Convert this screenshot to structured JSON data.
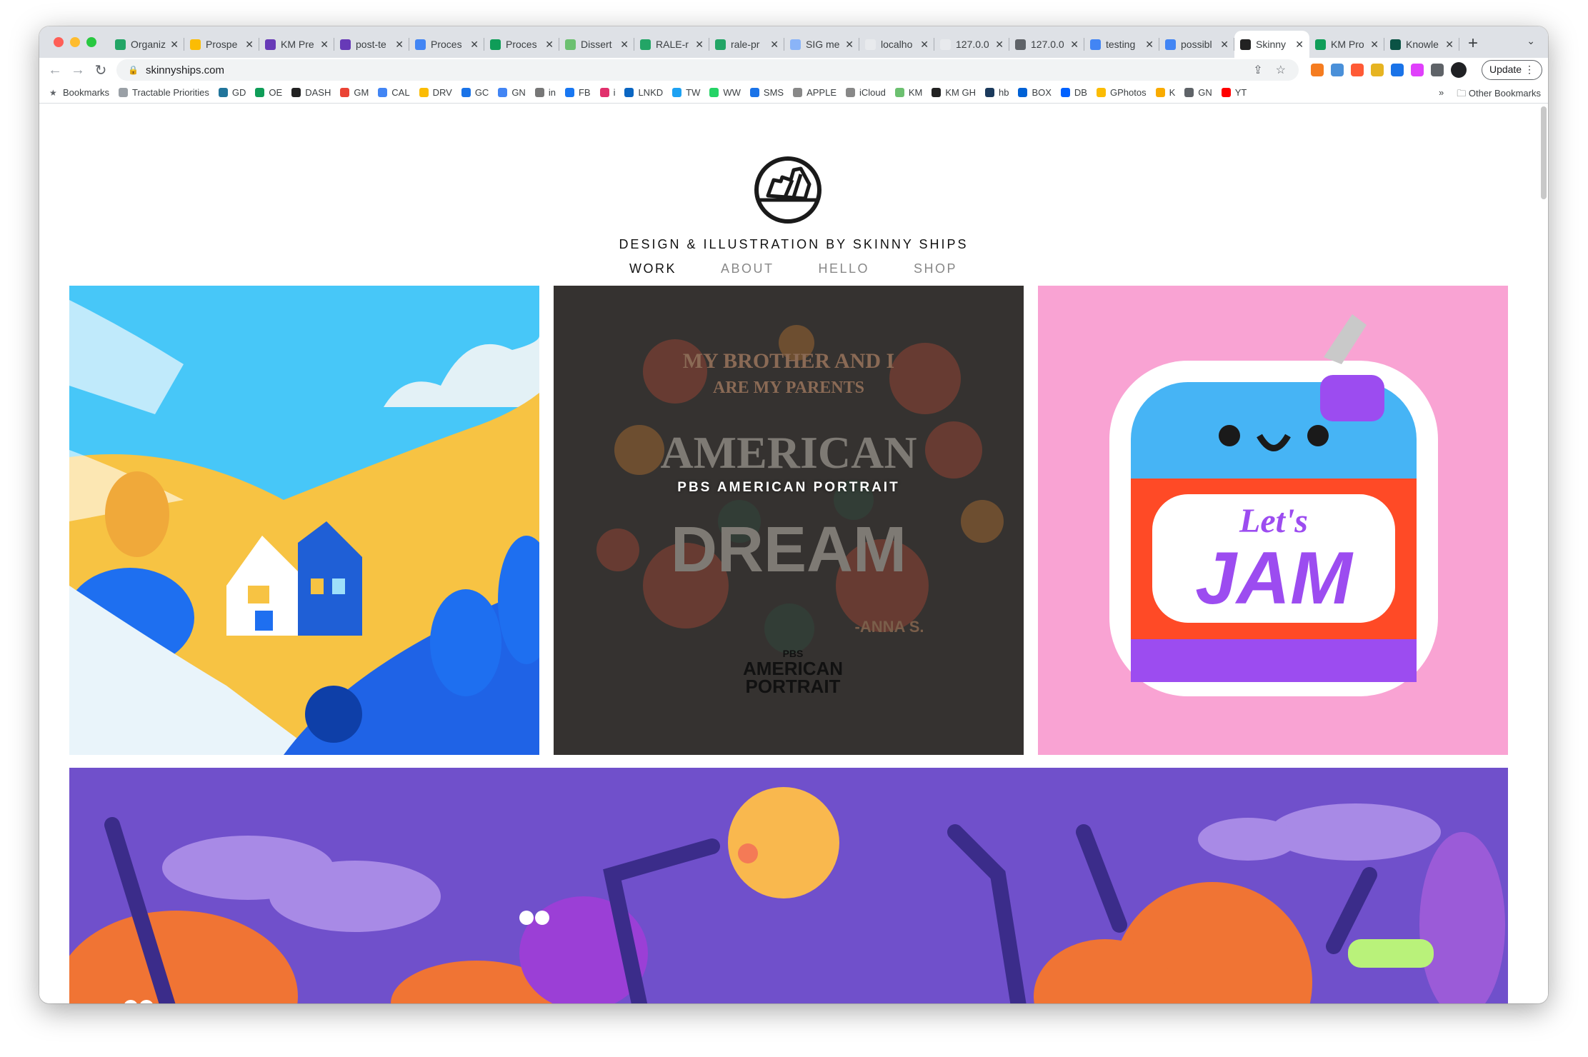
{
  "browser": {
    "tabs": [
      {
        "title": "Organiz",
        "color": "#23a566"
      },
      {
        "title": "Prospe",
        "color": "#fbbc04"
      },
      {
        "title": "KM Pre",
        "color": "#673ab7"
      },
      {
        "title": "post-te",
        "color": "#673ab7"
      },
      {
        "title": "Proces",
        "color": "#4285f4"
      },
      {
        "title": "Proces",
        "color": "#0f9d58"
      },
      {
        "title": "Dissert",
        "color": "#6cc070"
      },
      {
        "title": "RALE-r",
        "color": "#23a566"
      },
      {
        "title": "rale-pr",
        "color": "#23a566"
      },
      {
        "title": "SIG me",
        "color": "#8ab4f8"
      },
      {
        "title": "localho",
        "color": "#e8eaed"
      },
      {
        "title": "127.0.0",
        "color": "#e8eaed"
      },
      {
        "title": "127.0.0",
        "color": "#5f6368"
      },
      {
        "title": "testing",
        "color": "#4285f4"
      },
      {
        "title": "possibl",
        "color": "#4285f4"
      },
      {
        "title": "Skinny",
        "color": "#222222",
        "active": true
      },
      {
        "title": "KM Pro",
        "color": "#0f9d58"
      },
      {
        "title": "Knowle",
        "color": "#0b5345"
      }
    ],
    "url": "skinnyships.com",
    "update_label": "Update",
    "bookmarks": [
      {
        "label": "Bookmarks",
        "color": "#5f6368"
      },
      {
        "label": "Tractable Priorities",
        "color": "#9aa0a6"
      },
      {
        "label": "GD",
        "color": "#21759b"
      },
      {
        "label": "OE",
        "color": "#0f9d58"
      },
      {
        "label": "DASH",
        "color": "#222"
      },
      {
        "label": "GM",
        "color": "#ea4335"
      },
      {
        "label": "CAL",
        "color": "#4285f4"
      },
      {
        "label": "DRV",
        "color": "#fbbc04"
      },
      {
        "label": "GC",
        "color": "#1a73e8"
      },
      {
        "label": "GN",
        "color": "#4285f4"
      },
      {
        "label": "in",
        "color": "#777"
      },
      {
        "label": "FB",
        "color": "#1877f2"
      },
      {
        "label": "i",
        "color": "#e1306c"
      },
      {
        "label": "LNKD",
        "color": "#0a66c2"
      },
      {
        "label": "TW",
        "color": "#1da1f2"
      },
      {
        "label": "WW",
        "color": "#25d366"
      },
      {
        "label": "SMS",
        "color": "#1a73e8"
      },
      {
        "label": "APPLE",
        "color": "#888"
      },
      {
        "label": "iCloud",
        "color": "#888"
      },
      {
        "label": "KM",
        "color": "#6cc070"
      },
      {
        "label": "KM GH",
        "color": "#222"
      },
      {
        "label": "hb",
        "color": "#1b3a5c"
      },
      {
        "label": "BOX",
        "color": "#0061d5"
      },
      {
        "label": "DB",
        "color": "#0061ff"
      },
      {
        "label": "GPhotos",
        "color": "#fbbc04"
      },
      {
        "label": "K",
        "color": "#f9ab00"
      },
      {
        "label": "GN",
        "color": "#5f6368"
      },
      {
        "label": "YT",
        "color": "#ff0000"
      }
    ],
    "more_label": "»",
    "other_bookmarks": "Other Bookmarks",
    "extension_colors": [
      "#f57c20",
      "#4a90d9",
      "#ff5a36",
      "#e6b422",
      "#1a73e8",
      "#e040fb",
      "#5f6368",
      "#202124"
    ]
  },
  "site": {
    "tagline": "DESIGN & ILLUSTRATION BY SKINNY SHIPS",
    "nav": [
      {
        "label": "WORK",
        "active": true
      },
      {
        "label": "ABOUT"
      },
      {
        "label": "HELLO"
      },
      {
        "label": "SHOP"
      }
    ],
    "projects": [
      {
        "overlay": "PBS AMERICAN PORTRAIT",
        "art_text": [
          "MY BROTHER AND I",
          "ARE MY PARENTS",
          "AMERICAN",
          "DREAM",
          "-ANNA S.",
          "PBS",
          "AMERICAN",
          "PORTRAIT"
        ]
      },
      {
        "art_text": [
          "Let's",
          "JAM"
        ]
      }
    ]
  }
}
